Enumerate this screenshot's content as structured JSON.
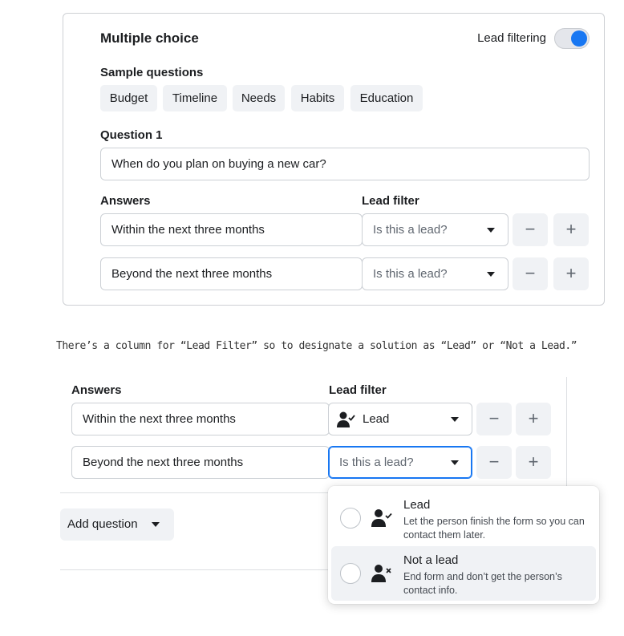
{
  "card": {
    "title": "Multiple choice",
    "lead_filtering_label": "Lead filtering",
    "lead_filtering_on": true,
    "sample_questions_label": "Sample questions",
    "sample_chips": [
      "Budget",
      "Timeline",
      "Needs",
      "Habits",
      "Education"
    ],
    "question_label": "Question 1",
    "question_value": "When do you plan on buying a new car?",
    "answers_header": "Answers",
    "lead_filter_header": "Lead filter",
    "answers": [
      {
        "text": "Within the next three months",
        "lead_placeholder": "Is this a lead?"
      },
      {
        "text": "Beyond the next three months",
        "lead_placeholder": "Is this a lead?"
      }
    ],
    "minus_symbol": "−",
    "plus_symbol": "+"
  },
  "caption": "There’s a column for “Lead Filter” so to designate a solution as “Lead” or “Not a Lead.”",
  "panel": {
    "answers_header": "Answers",
    "lead_filter_header": "Lead filter",
    "answers": [
      {
        "text": "Within the next three months",
        "lead_value": "Lead"
      },
      {
        "text": "Beyond the next three months",
        "lead_placeholder": "Is this a lead?"
      }
    ],
    "minus_symbol": "−",
    "plus_symbol": "+",
    "add_question_label": "Add question",
    "dropdown": [
      {
        "title": "Lead",
        "description": "Let the person finish the form so you can contact them later.",
        "icon": "person-check-icon"
      },
      {
        "title": "Not a lead",
        "description": "End form and don’t get the person’s contact info.",
        "icon": "person-x-icon"
      }
    ]
  },
  "colors": {
    "accent": "#1877f2",
    "chip_bg": "#f0f2f5",
    "border": "#ccd0d5"
  }
}
